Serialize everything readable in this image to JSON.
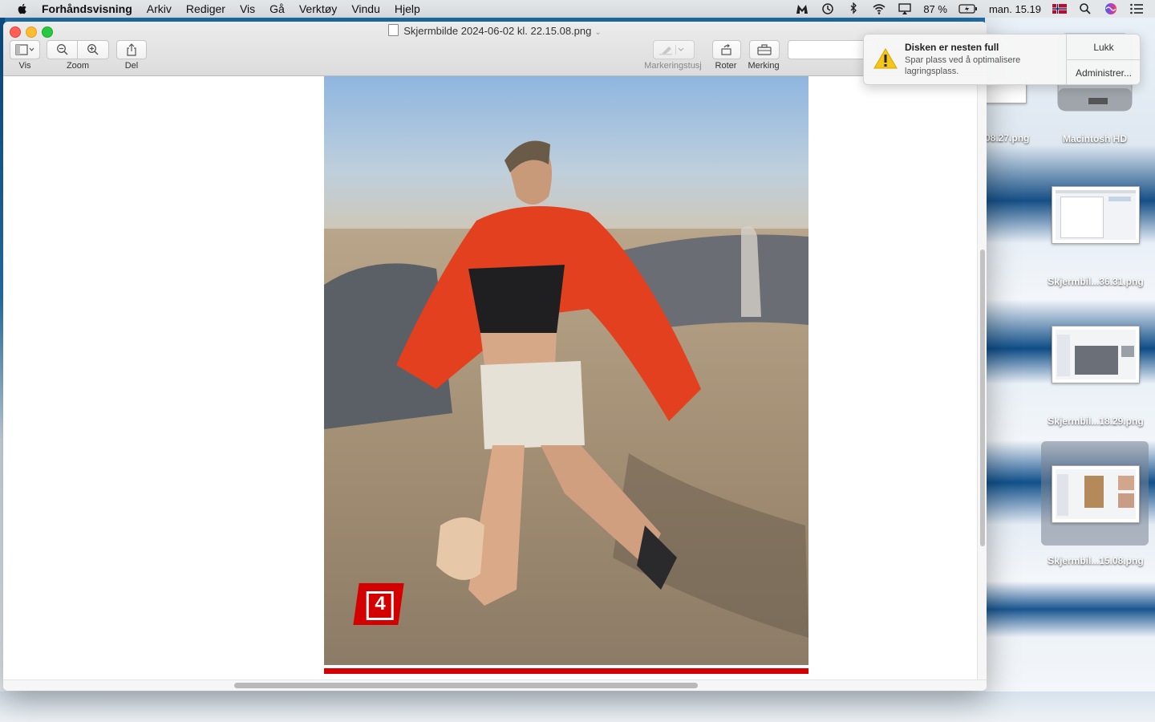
{
  "menubar": {
    "app_name": "Forhåndsvisning",
    "items": [
      "Arkiv",
      "Rediger",
      "Vis",
      "Gå",
      "Verktøy",
      "Vindu",
      "Hjelp"
    ],
    "battery": "87 %",
    "clock": "man. 15.19"
  },
  "window": {
    "title": "Skjermbilde 2024-06-02 kl. 22.15.08.png",
    "toolbar": {
      "view_label": "Vis",
      "zoom_label": "Zoom",
      "share_label": "Del",
      "markup_pen_label": "Markeringstusj",
      "rotate_label": "Roter",
      "markup_label": "Merking"
    },
    "photo": {
      "badge_text": "4",
      "badge_color": "#d40000"
    }
  },
  "notification": {
    "title": "Disken er nesten full",
    "body": "Spar plass ved å optimalisere lagringsplass.",
    "close_label": "Lukk",
    "manage_label": "Administrer..."
  },
  "desktop": {
    "items": [
      {
        "label": "08.27.png"
      },
      {
        "label": "Macintosh HD"
      },
      {
        "label": "Skjermbil...36.31.png"
      },
      {
        "label": "Skjermbil...18.29.png"
      },
      {
        "label": "Skjermbil...15.08.png"
      }
    ]
  }
}
